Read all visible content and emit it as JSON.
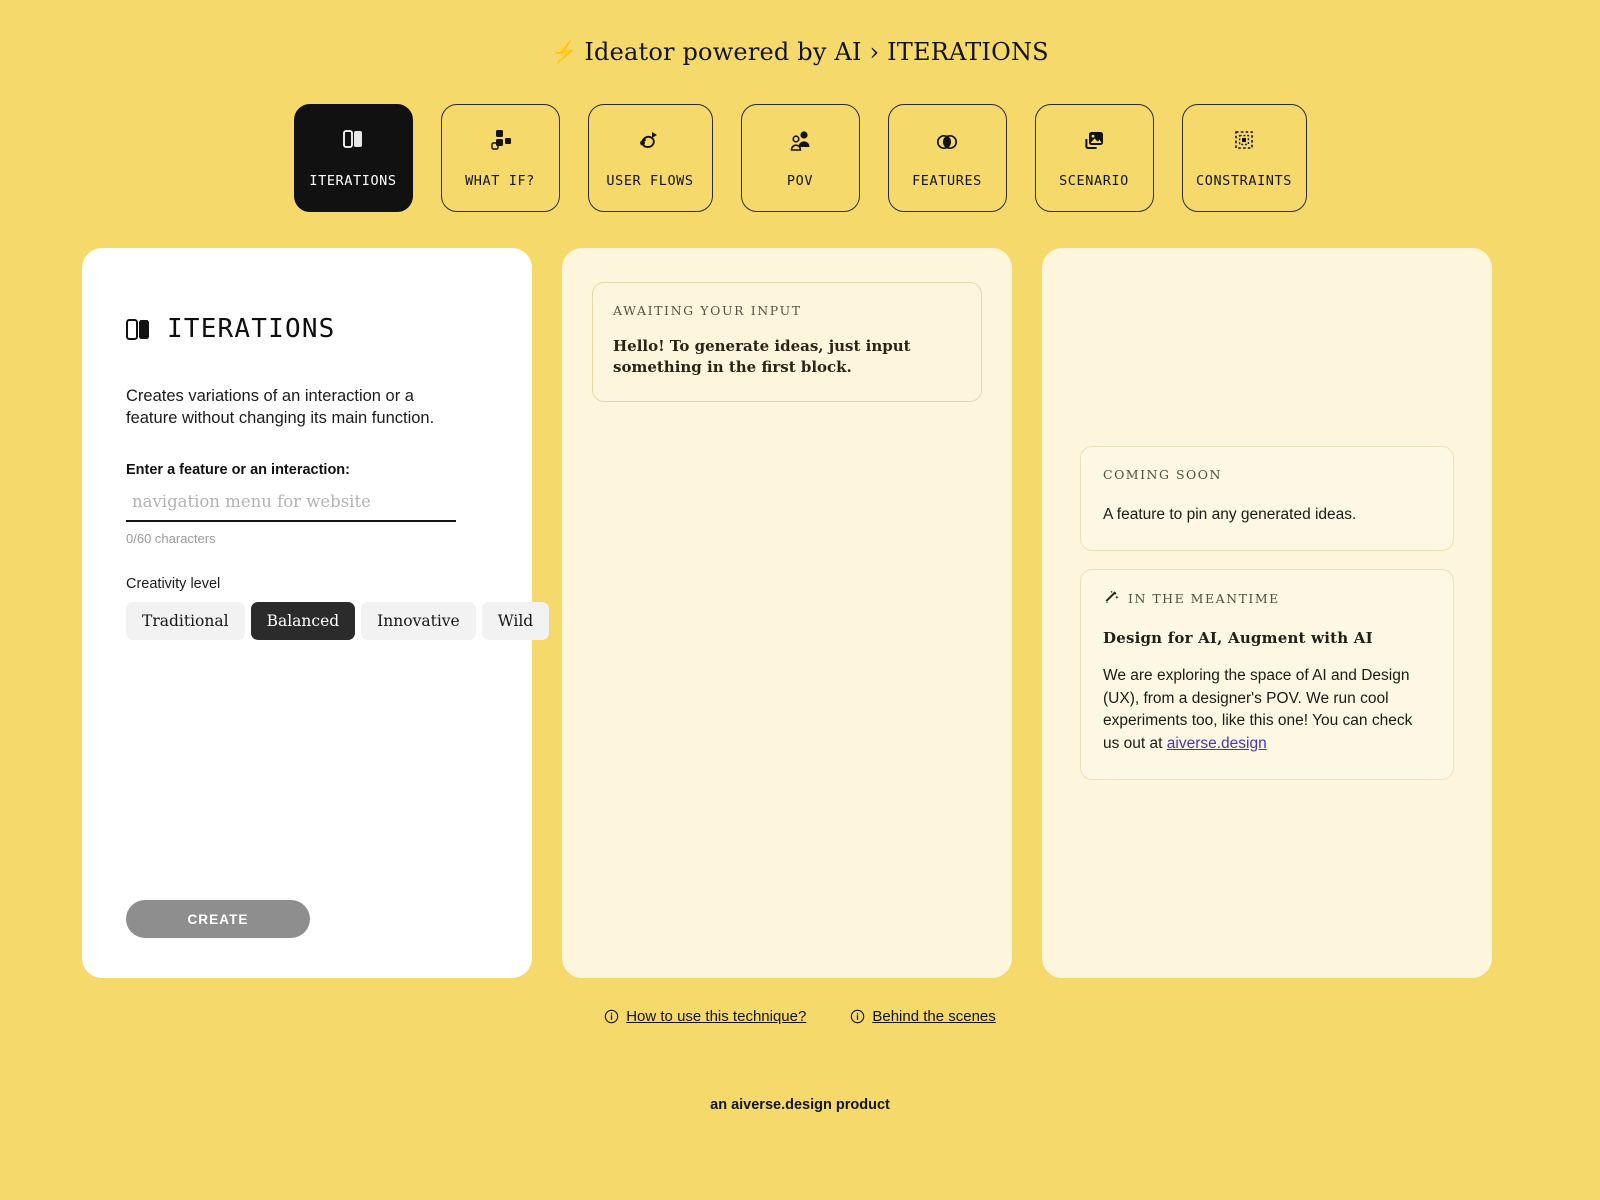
{
  "header": {
    "bolt_icon": "lightning-bolt-icon",
    "title": "Ideator powered by AI › ITERATIONS"
  },
  "tabs": [
    {
      "label": "ITERATIONS",
      "icon": "panels-icon",
      "active": true
    },
    {
      "label": "WHAT IF?",
      "icon": "shapes-icon",
      "active": false
    },
    {
      "label": "USER FLOWS",
      "icon": "flow-arrow-icon",
      "active": false
    },
    {
      "label": "POV",
      "icon": "users-icon",
      "active": false
    },
    {
      "label": "FEATURES",
      "icon": "venn-circles-icon",
      "active": false
    },
    {
      "label": "SCENARIO",
      "icon": "image-icon",
      "active": false
    },
    {
      "label": "CONSTRAINTS",
      "icon": "dashed-frame-icon",
      "active": false
    }
  ],
  "left_panel": {
    "icon": "panels-icon",
    "title": "ITERATIONS",
    "description": "Creates variations of an interaction or a feature without changing its main function.",
    "field_label": "Enter a feature or an interaction:",
    "input_value": "",
    "input_placeholder": "navigation menu for website",
    "char_count": "0/60 characters",
    "creativity_label": "Creativity level",
    "creativity_options": [
      {
        "label": "Traditional",
        "selected": false
      },
      {
        "label": "Balanced",
        "selected": true
      },
      {
        "label": "Innovative",
        "selected": false
      },
      {
        "label": "Wild",
        "selected": false
      }
    ],
    "create_button": "CREATE"
  },
  "mid_panel": {
    "kicker": "AWAITING YOUR INPUT",
    "message": "Hello! To generate ideas, just input something in the first block."
  },
  "right_panel": {
    "coming_soon": {
      "kicker": "COMING SOON",
      "text": "A feature to pin any generated ideas."
    },
    "meantime": {
      "icon": "magic-wand-icon",
      "kicker": "IN THE MEANTIME",
      "heading": "Design for AI, Augment with AI",
      "text_before_link": "We are exploring the space of AI and Design (UX), from a designer's POV. We run cool experiments too, like this one! You can check us out at ",
      "link_text": "aiverse.design"
    }
  },
  "footer": {
    "links": [
      {
        "icon": "info-icon",
        "label": "How to use this technique?"
      },
      {
        "icon": "info-icon",
        "label": "Behind the scenes"
      }
    ],
    "product_line": "an aiverse.design product"
  },
  "colors": {
    "page_background": "#f5d96b",
    "card_cream": "#fdf6dc",
    "card_white": "#ffffff",
    "accent_dark": "#111111",
    "link_blue": "#4338b8",
    "disabled_gray": "#8e8e8e"
  }
}
